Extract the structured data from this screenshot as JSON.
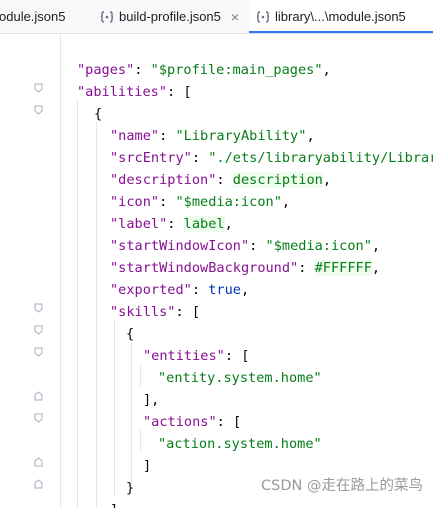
{
  "tabs": [
    {
      "label": "odule.json5",
      "active": false,
      "icon": "json-file-icon"
    },
    {
      "label": "build-profile.json5",
      "active": false,
      "icon": "json-file-icon",
      "close": "×"
    },
    {
      "label": "library\\...\\module.json5",
      "active": true,
      "icon": "json-file-icon"
    }
  ],
  "code": {
    "pages_key": "\"pages\"",
    "pages_value": "\"$profile:main_pages\"",
    "abilities_key": "\"abilities\"",
    "name_key": "\"name\"",
    "name_value": "\"LibraryAbility\"",
    "srcEntry_key": "\"srcEntry\"",
    "srcEntry_value": "\"./ets/libraryability/Library",
    "description_key": "\"description\"",
    "description_value": "description",
    "icon_key": "\"icon\"",
    "icon_value": "\"$media:icon\"",
    "label_key": "\"label\"",
    "label_value": "label",
    "startWindowIcon_key": "\"startWindowIcon\"",
    "startWindowIcon_value": "\"$media:icon\"",
    "startWindowBackground_key": "\"startWindowBackground\"",
    "startWindowBackground_value": "#FFFFFF",
    "exported_key": "\"exported\"",
    "exported_value": "true",
    "skills_key": "\"skills\"",
    "entities_key": "\"entities\"",
    "entities_value": "\"entity.system.home\"",
    "actions_key": "\"actions\"",
    "actions_value": "\"action.system.home\""
  },
  "colors": {
    "key": "#871094",
    "string": "#067d17",
    "boolean": "#0033b3",
    "active_tab_accent": "#3574f0"
  },
  "watermark": "CSDN @走在路上的菜鸟"
}
